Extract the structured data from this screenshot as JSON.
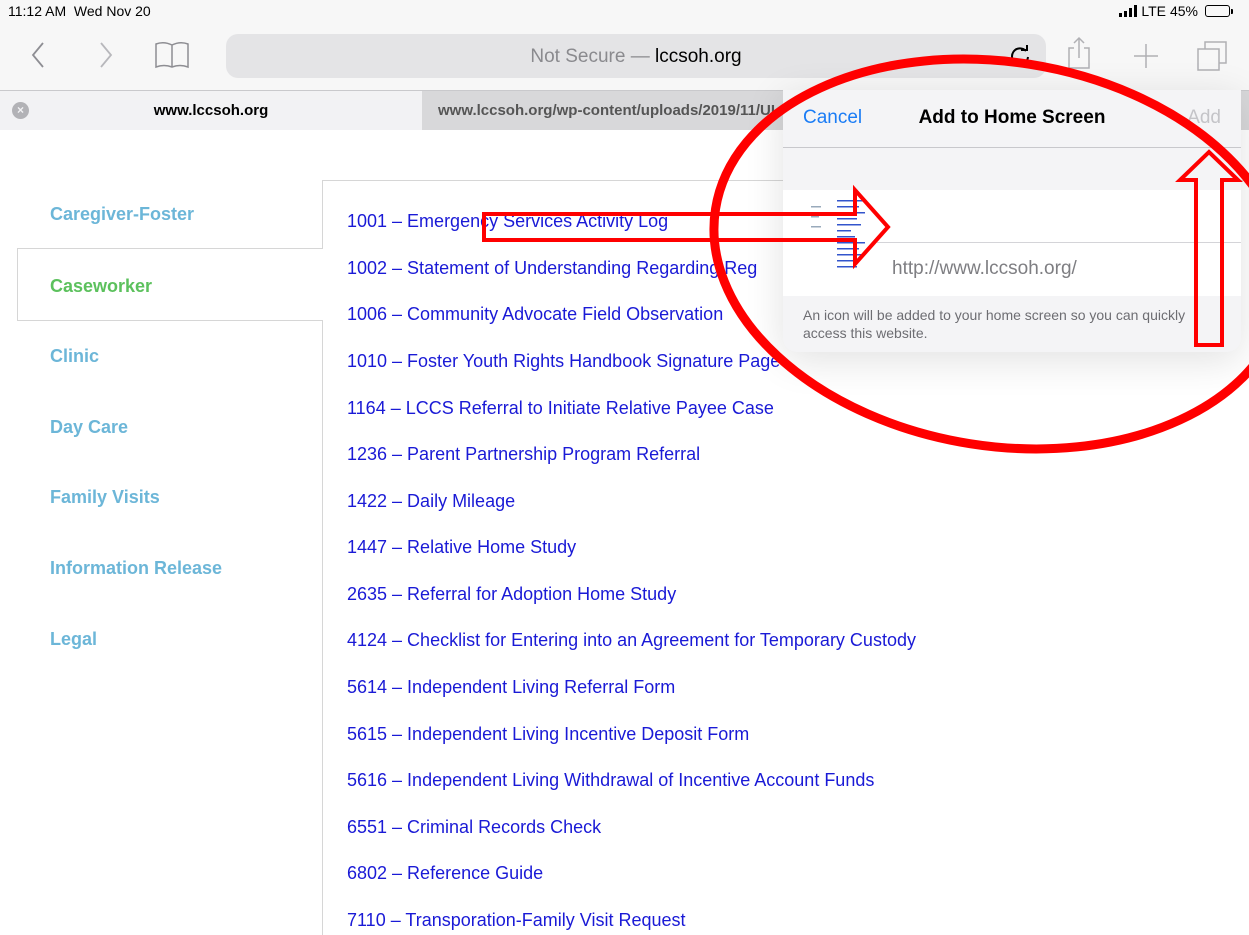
{
  "status_bar": {
    "time": "11:12 AM",
    "date": "Wed Nov 20",
    "network": "LTE",
    "battery": "45%",
    "battery_level": 0.45
  },
  "toolbar": {
    "back_icon": "chevron-left-icon",
    "forward_icon": "chevron-right-icon",
    "bookmarks_icon": "book-icon",
    "url_prefix": "Not Secure — ",
    "url_domain": "lccsoh.org",
    "reload_icon": "reload-icon",
    "share_icon": "share-icon",
    "new_tab_icon": "plus-icon",
    "tabs_icon": "tabs-icon"
  },
  "tabs": [
    {
      "label": "www.lccsoh.org",
      "active": true
    },
    {
      "label": "www.lccsoh.org/wp-content/uploads/2019/11/UI",
      "active": false
    }
  ],
  "sidebar": {
    "items": [
      {
        "label": "Caregiver-Foster",
        "active": false
      },
      {
        "label": "Caseworker",
        "active": true
      },
      {
        "label": "Clinic",
        "active": false
      },
      {
        "label": "Day Care",
        "active": false
      },
      {
        "label": "Family Visits",
        "active": false
      },
      {
        "label": "Information Release",
        "active": false
      },
      {
        "label": "Legal",
        "active": false
      }
    ]
  },
  "forms": [
    "1001 – Emergency Services Activity Log",
    "1002 – Statement of Understanding Regarding Reg",
    "1006 – Community Advocate Field Observation",
    "1010 – Foster Youth Rights Handbook Signature Page",
    "1164 – LCCS Referral to Initiate Relative Payee Case",
    "1236 – Parent Partnership Program Referral",
    "1422 – Daily Mileage",
    "1447 – Relative Home Study",
    "2635 – Referral for Adoption Home Study",
    "4124 – Checklist for Entering into an Agreement for Temporary Custody",
    "5614 – Independent Living Referral Form",
    "5615 – Independent Living Incentive Deposit Form",
    "5616 – Independent Living Withdrawal of Incentive Account Funds",
    "6551 – Criminal Records Check",
    "6802 – Reference Guide",
    "7110 – Transporation-Family Visit Request"
  ],
  "popover": {
    "cancel_label": "Cancel",
    "title": "Add to Home Screen",
    "add_label": "Add",
    "name_value": "",
    "url": "http://www.lccsoh.org/",
    "note": "An icon will be added to your home screen so you can quickly access this website."
  },
  "colors": {
    "link": "#1a1ad6",
    "sidebar": "#6cb6d8",
    "sidebar_active": "#5cc15d",
    "ios_blue": "#1a7cf5",
    "annotation_red": "#ff0000"
  }
}
